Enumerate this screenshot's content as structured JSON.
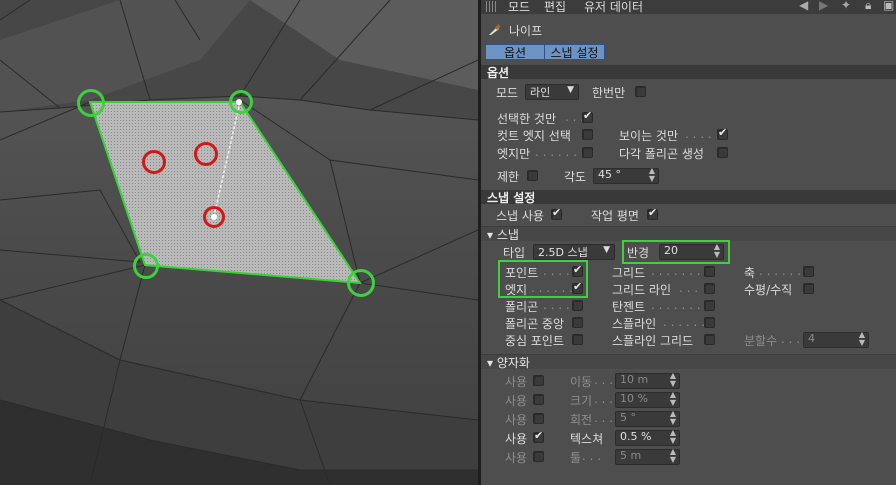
{
  "menu": {
    "mode": "모드",
    "edit": "편집",
    "userdata": "유저 데이터"
  },
  "tool": {
    "name": "나이프"
  },
  "tabs": [
    "옵션",
    "스냅 설정"
  ],
  "options": {
    "header": "옵션",
    "mode_label": "모드",
    "mode_value": "라인",
    "once_label": "한번만",
    "once": false,
    "selected_only_label": "선택한 것만",
    "selected_only": true,
    "cut_edge_select_label": "컷트 엣지 선택",
    "cut_edge_select": false,
    "visible_only_label": "보이는 것만",
    "visible_only": true,
    "edges_only_label": "엣지만",
    "edges_only": false,
    "ngon_label": "다각 폴리곤 생성",
    "ngon": false,
    "restrict_label": "제한",
    "restrict": false,
    "angle_label": "각도",
    "angle_value": "45 °"
  },
  "snap": {
    "header": "스냅 설정",
    "enable_label": "스냅 사용",
    "enable": true,
    "workplane_label": "작업 평면",
    "workplane": true,
    "sub_header": "스냅",
    "type_label": "타입",
    "type_value": "2.5D 스냅",
    "radius_label": "반경",
    "radius_value": "20",
    "point_label": "포인트",
    "point": true,
    "grid_label": "그리드",
    "grid": false,
    "axis_label": "축",
    "axis": false,
    "edge_label": "엣지",
    "edge": true,
    "grid_line_label": "그리드 라인",
    "grid_line": false,
    "horiz_vert_label": "수평/수직",
    "horiz_vert": false,
    "polygon_label": "폴리곤",
    "polygon": false,
    "tangent_label": "탄젠트",
    "tangent": false,
    "polygon_center_label": "폴리곤 중앙",
    "polygon_center": false,
    "spline_label": "스플라인",
    "spline": false,
    "midpoint_label": "중심 포인트",
    "midpoint": false,
    "spline_grid_label": "스플라인 그리드",
    "spline_grid": false,
    "subdiv_label": "분할수",
    "subdiv_value": "4"
  },
  "quantize": {
    "header": "양자화",
    "rows": [
      {
        "use_label": "사용",
        "checked": false,
        "name": "이동",
        "value": "10 m"
      },
      {
        "use_label": "사용",
        "checked": false,
        "name": "크기",
        "value": "10 %"
      },
      {
        "use_label": "사용",
        "checked": false,
        "name": "회전",
        "value": "5 °"
      },
      {
        "use_label": "사용",
        "checked": true,
        "name": "텍스쳐",
        "value": "0.5 %"
      },
      {
        "use_label": "사용",
        "checked": false,
        "name": "툴",
        "value": "5 m"
      }
    ]
  },
  "colors": {
    "snap_highlight": "#3ed13e",
    "marker_red": "#d01818",
    "tab_active": "#6d93c4"
  }
}
